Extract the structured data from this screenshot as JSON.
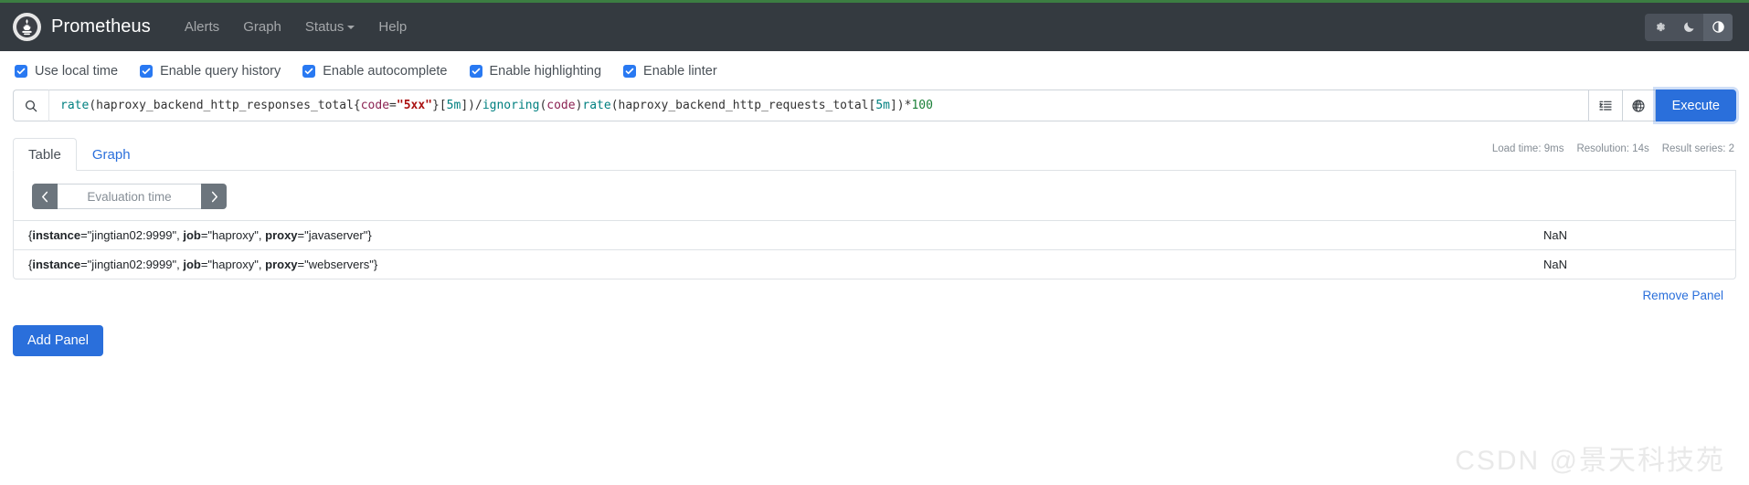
{
  "navbar": {
    "brand": "Prometheus",
    "logo_icon": "prometheus-logo-icon",
    "links": [
      {
        "label": "Alerts",
        "has_caret": false
      },
      {
        "label": "Graph",
        "has_caret": false
      },
      {
        "label": "Status",
        "has_caret": true
      },
      {
        "label": "Help",
        "has_caret": false
      }
    ],
    "theme_buttons": [
      {
        "icon": "sun-gear-icon",
        "title": "Light",
        "active": false
      },
      {
        "icon": "moon-icon",
        "title": "Dark",
        "active": false
      },
      {
        "icon": "half-circle-auto-icon",
        "title": "Auto",
        "active": true
      }
    ],
    "background_color": "#343a40",
    "accent_color": "#3c7d42"
  },
  "options": {
    "items": [
      {
        "label": "Use local time",
        "checked": true
      },
      {
        "label": "Enable query history",
        "checked": true
      },
      {
        "label": "Enable autocomplete",
        "checked": true
      },
      {
        "label": "Enable highlighting",
        "checked": true
      },
      {
        "label": "Enable linter",
        "checked": true
      }
    ],
    "checkbox_color": "#2979f2"
  },
  "expression": {
    "search_icon": "search-icon",
    "raw": "rate(haproxy_backend_http_responses_total{code=\"5xx\"}[5m]) / ignoring(code) rate(haproxy_backend_http_requests_total[5m]) * 100",
    "tokens": [
      {
        "text": "rate",
        "type": "func"
      },
      {
        "text": "(haproxy_backend_http_responses_total{",
        "type": "plain"
      },
      {
        "text": "code",
        "type": "label"
      },
      {
        "text": "=",
        "type": "plain"
      },
      {
        "text": "\"5xx\"",
        "type": "string"
      },
      {
        "text": "}[",
        "type": "plain"
      },
      {
        "text": "5m",
        "type": "dur"
      },
      {
        "text": "])",
        "type": "plain"
      },
      {
        "text": " / ",
        "type": "op"
      },
      {
        "text": "ignoring",
        "type": "func"
      },
      {
        "text": "(",
        "type": "plain"
      },
      {
        "text": "code",
        "type": "label"
      },
      {
        "text": ") ",
        "type": "plain"
      },
      {
        "text": "rate",
        "type": "func"
      },
      {
        "text": "(haproxy_backend_http_requests_total[",
        "type": "plain"
      },
      {
        "text": "5m",
        "type": "dur"
      },
      {
        "text": "])",
        "type": "plain"
      },
      {
        "text": " * ",
        "type": "op"
      },
      {
        "text": "100",
        "type": "num"
      }
    ],
    "format_button_icon": "format-expression-icon",
    "globe_button_icon": "globe-icon",
    "execute_label": "Execute",
    "execute_color": "#2a6fdb"
  },
  "panel": {
    "tabs": [
      {
        "label": "Table",
        "active": true
      },
      {
        "label": "Graph",
        "active": false
      }
    ],
    "stats": {
      "load_time": "Load time: 9ms",
      "resolution": "Resolution: 14s",
      "result_series": "Result series: 2"
    },
    "evaluation_time": {
      "prev_icon": "chevron-left-icon",
      "next_icon": "chevron-right-icon",
      "placeholder": "Evaluation time",
      "value": ""
    },
    "table": {
      "rows": [
        {
          "labels": [
            {
              "name": "instance",
              "value": "\"jingtian02:9999\""
            },
            {
              "name": "job",
              "value": "\"haproxy\""
            },
            {
              "name": "proxy",
              "value": "\"javaserver\""
            }
          ],
          "value": "NaN"
        },
        {
          "labels": [
            {
              "name": "instance",
              "value": "\"jingtian02:9999\""
            },
            {
              "name": "job",
              "value": "\"haproxy\""
            },
            {
              "name": "proxy",
              "value": "\"webservers\""
            }
          ],
          "value": "NaN"
        }
      ]
    },
    "remove_panel_label": "Remove Panel"
  },
  "footer": {
    "add_panel_label": "Add Panel",
    "watermark": "CSDN @景天科技苑"
  }
}
